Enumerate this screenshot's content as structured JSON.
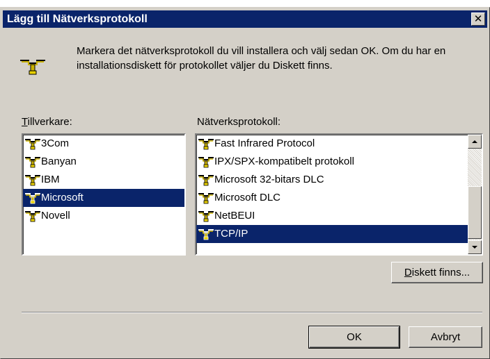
{
  "window": {
    "title": "Lägg till Nätverksprotokoll",
    "close_glyph": "✕"
  },
  "description": "Markera det nätverksprotokoll du vill installera och välj sedan OK. Om du har en installationsdiskett för protokollet väljer du Diskett finns.",
  "manufacturers": {
    "label_mnemonic": "T",
    "label_rest": "illverkare:",
    "items": [
      {
        "label": "3Com",
        "selected": false
      },
      {
        "label": "Banyan",
        "selected": false
      },
      {
        "label": "IBM",
        "selected": false
      },
      {
        "label": "Microsoft",
        "selected": true
      },
      {
        "label": "Novell",
        "selected": false
      }
    ]
  },
  "protocols": {
    "label": "Nätverksprotokoll:",
    "items": [
      {
        "label": "Fast Infrared Protocol",
        "selected": false
      },
      {
        "label": "IPX/SPX-kompatibelt protokoll",
        "selected": false
      },
      {
        "label": "Microsoft 32-bitars DLC",
        "selected": false
      },
      {
        "label": "Microsoft DLC",
        "selected": false
      },
      {
        "label": "NetBEUI",
        "selected": false
      },
      {
        "label": "TCP/IP",
        "selected": true
      }
    ]
  },
  "buttons": {
    "disk_mnemonic": "D",
    "disk_rest": "iskett finns...",
    "ok": "OK",
    "cancel": "Avbryt"
  },
  "colors": {
    "face": "#d4d0c8",
    "selection": "#0a246a",
    "titlebar": "#0a246a"
  },
  "icons": {
    "protocol": "network-protocol-icon"
  }
}
